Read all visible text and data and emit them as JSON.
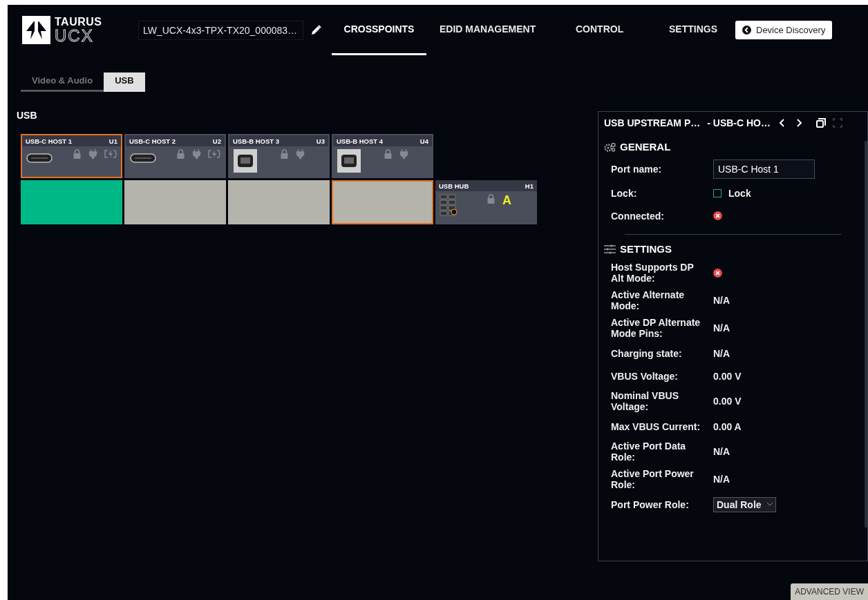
{
  "header": {
    "logo": {
      "line_1": "TAURUS",
      "line_2": "UCX"
    },
    "device_name": "LW_UCX-4x3-TPX-TX20_000083…",
    "nav": [
      {
        "label": "CROSSPOINTS",
        "selected": true
      },
      {
        "label": "EDID MANAGEMENT",
        "selected": false
      },
      {
        "label": "CONTROL",
        "selected": false
      },
      {
        "label": "SETTINGS",
        "selected": false
      }
    ],
    "discovery_button": "Device Discovery"
  },
  "sub_tabs": [
    {
      "label": "Video & Audio",
      "selected": false
    },
    {
      "label": "USB",
      "selected": true
    }
  ],
  "section_title": "USB",
  "ports": [
    {
      "name": "USB-C HOST 1",
      "id": "U1",
      "kind": "usb-c",
      "selected": true
    },
    {
      "name": "USB-C HOST 2",
      "id": "U2",
      "kind": "usb-c",
      "selected": false
    },
    {
      "name": "USB-B HOST 3",
      "id": "U3",
      "kind": "usb-b",
      "selected": false
    },
    {
      "name": "USB-B HOST 4",
      "id": "U4",
      "kind": "usb-b",
      "selected": false
    }
  ],
  "crosspoints": [
    {
      "connected": true,
      "selected": false
    },
    {
      "connected": false,
      "selected": false
    },
    {
      "connected": false,
      "selected": false
    },
    {
      "connected": false,
      "selected": true
    }
  ],
  "hub": {
    "name": "USB HUB",
    "id": "H1",
    "letter": "A"
  },
  "panel": {
    "title": "USB UPSTREAM P…",
    "subtitle": "- USB-C HO…",
    "sections": [
      {
        "title": "GENERAL",
        "kind": "gears",
        "rows": [
          {
            "label": "Port name:",
            "kind": "field",
            "value": "USB-C Host 1"
          },
          {
            "label": "Lock:",
            "kind": "checkbox",
            "value": "Lock",
            "checked": false
          },
          {
            "label": "Connected:",
            "kind": "status",
            "on": false
          }
        ]
      },
      {
        "title": "SETTINGS",
        "kind": "sliders",
        "rows": [
          {
            "label": "Host Supports DP Alt Mode:",
            "kind": "status",
            "on": false
          },
          {
            "label": "Active Alternate Mode:",
            "kind": "value",
            "value": "N/A"
          },
          {
            "label": "Active DP Alternate Mode Pins:",
            "kind": "value",
            "value": "N/A"
          },
          {
            "label": "Charging state:",
            "kind": "value",
            "value": "N/A"
          },
          {
            "label": "VBUS Voltage:",
            "kind": "value",
            "value": "0.00 V"
          },
          {
            "label": "Nominal VBUS Voltage:",
            "kind": "value",
            "value": "0.00 V"
          },
          {
            "label": "Max VBUS Current:",
            "kind": "value",
            "value": "0.00 A"
          },
          {
            "label": "Active Port Data Role:",
            "kind": "value",
            "value": "N/A"
          },
          {
            "label": "Active Port Power Role:",
            "kind": "value",
            "value": "N/A"
          },
          {
            "label": "Port Power Role:",
            "kind": "select",
            "value": "Dual Role"
          }
        ]
      }
    ]
  },
  "advanced_view_button": "ADVANCED VIEW"
}
